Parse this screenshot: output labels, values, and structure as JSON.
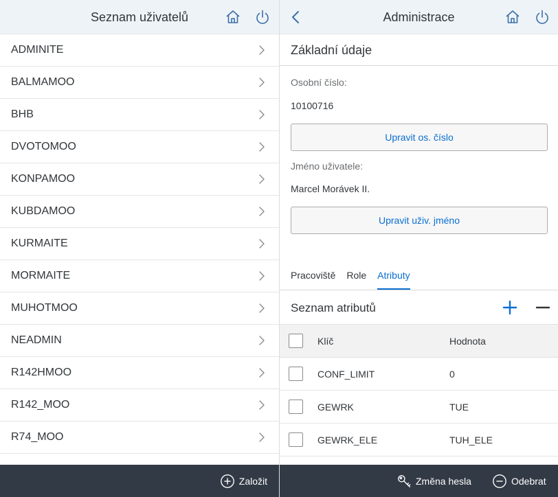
{
  "left": {
    "header_title": "Seznam uživatelů",
    "users": [
      "ADMINITE",
      "BALMAMOO",
      "BHB",
      "DVOTOMOO",
      "KONPAMOO",
      "KUBDAMOO",
      "KURMAITE",
      "MORMAITE",
      "MUHOTMOO",
      "NEADMIN",
      "R142HMOO",
      "R142_MOO",
      "R74_MOO"
    ],
    "footer_create_label": "Založit"
  },
  "right": {
    "header_title": "Administrace",
    "section_title": "Základní údaje",
    "personal_number_label": "Osobní číslo:",
    "personal_number_value": "10100716",
    "edit_number_button": "Upravit os. číslo",
    "username_label": "Jméno uživatele:",
    "username_value": "Marcel Morávek II.",
    "edit_username_button": "Upravit uživ. jméno",
    "tabs": [
      "Pracoviště",
      "Role",
      "Atributy"
    ],
    "active_tab": "Atributy",
    "attributes_title": "Seznam atributů",
    "columns": {
      "key": "Klíč",
      "value": "Hodnota"
    },
    "rows": [
      {
        "key": "CONF_LIMIT",
        "value": "0"
      },
      {
        "key": "GEWRK",
        "value": "TUE"
      },
      {
        "key": "GEWRK_ELE",
        "value": "TUH_ELE"
      }
    ],
    "footer_change_password_label": "Změna hesla",
    "footer_remove_label": "Odebrat"
  },
  "icons": {
    "home": "home-icon",
    "power": "power-icon",
    "back": "chevron-left-icon",
    "chevron": "chevron-right-icon",
    "add": "plus-icon",
    "remove": "minus-icon",
    "key": "key-icon",
    "create": "add-circle-icon",
    "remove_circle": "minus-circle-icon"
  },
  "colors": {
    "accent": "#0a6ed1",
    "header_bg": "#eef3f8",
    "footer_bg": "#323a45"
  }
}
